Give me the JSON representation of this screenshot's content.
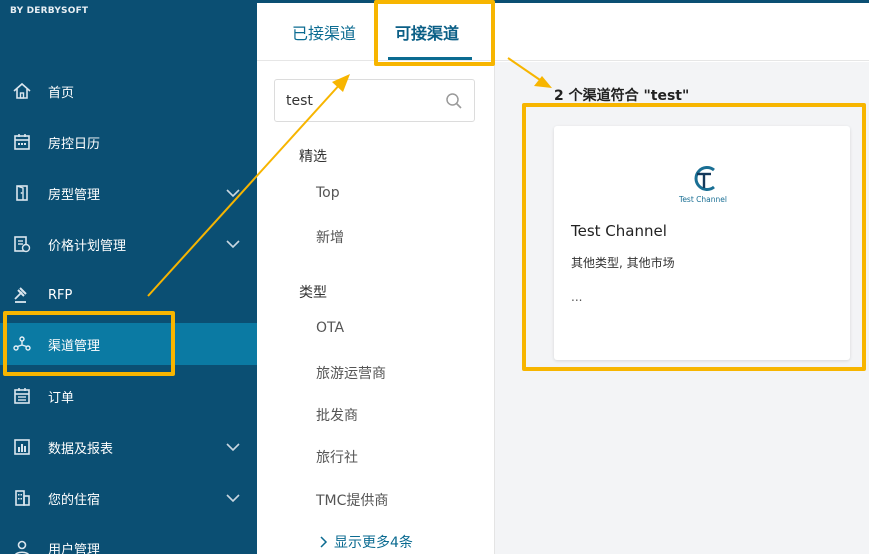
{
  "brand": {
    "subtitle": "BY DERBYSOFT"
  },
  "sidebar": {
    "items": [
      {
        "label": "首页",
        "icon": "home-icon",
        "has_chevron": false,
        "active": false
      },
      {
        "label": "房控日历",
        "icon": "calendar-icon",
        "has_chevron": false,
        "active": false
      },
      {
        "label": "房型管理",
        "icon": "door-icon",
        "has_chevron": true,
        "active": false
      },
      {
        "label": "价格计划管理",
        "icon": "price-plan-icon",
        "has_chevron": true,
        "active": false
      },
      {
        "label": "RFP",
        "icon": "gavel-icon",
        "has_chevron": false,
        "active": false
      },
      {
        "label": "渠道管理",
        "icon": "network-icon",
        "has_chevron": false,
        "active": true
      },
      {
        "label": "订单",
        "icon": "order-icon",
        "has_chevron": false,
        "active": false
      },
      {
        "label": "数据及报表",
        "icon": "chart-icon",
        "has_chevron": true,
        "active": false
      },
      {
        "label": "您的住宿",
        "icon": "building-icon",
        "has_chevron": true,
        "active": false
      },
      {
        "label": "用户管理",
        "icon": "user-icon",
        "has_chevron": false,
        "active": false
      }
    ]
  },
  "tabs": {
    "connected": "已接渠道",
    "available": "可接渠道"
  },
  "search": {
    "value": "test"
  },
  "filters": {
    "featured_title": "精选",
    "featured_items": [
      "Top",
      "新增"
    ],
    "type_title": "类型",
    "type_items": [
      "OTA",
      "旅游运营商",
      "批发商",
      "旅行社",
      "TMC提供商"
    ],
    "show_more": "显示更多4条"
  },
  "results": {
    "count_text": "2 个渠道符合 \"test\"",
    "card": {
      "logo_text": "Test Channel",
      "title": "Test Channel",
      "tags": "其他类型, 其他市场",
      "more": "..."
    }
  },
  "colors": {
    "sidebar_bg": "#0b4f73",
    "active_item_bg": "#0b7aa3",
    "accent": "#0b6b91",
    "highlight": "#f7b500"
  }
}
